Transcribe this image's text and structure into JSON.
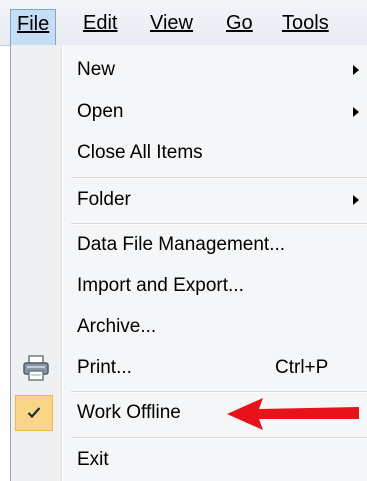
{
  "menubar": {
    "items": [
      {
        "label": "File"
      },
      {
        "label": "Edit"
      },
      {
        "label": "View"
      },
      {
        "label": "Go"
      },
      {
        "label": "Tools"
      }
    ]
  },
  "menu": {
    "items": [
      {
        "label": "New",
        "submenu": true
      },
      {
        "label": "Open",
        "submenu": true
      },
      {
        "label": "Close All Items"
      },
      {
        "label": "Folder",
        "submenu": true
      },
      {
        "label": "Data File Management..."
      },
      {
        "label": "Import and Export..."
      },
      {
        "label": "Archive..."
      },
      {
        "label": "Print...",
        "shortcut": "Ctrl+P",
        "icon": "printer-icon"
      },
      {
        "label": "Work Offline",
        "checked": true,
        "icon": "checkmark-icon"
      },
      {
        "label": "Exit"
      }
    ]
  },
  "colors": {
    "annotation_arrow": "#e8121b",
    "checked_highlight": "#fad587",
    "active_menubar": "#c7ddf4"
  }
}
